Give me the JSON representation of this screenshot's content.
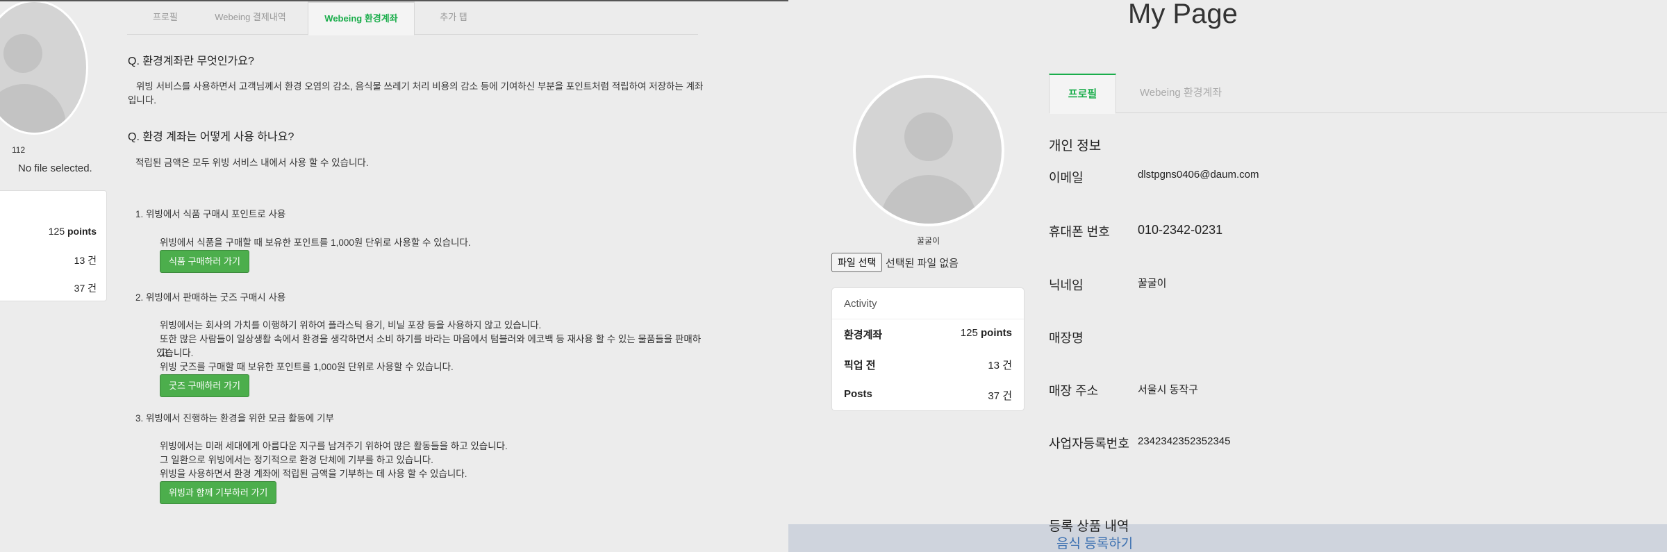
{
  "left": {
    "nickname": "112",
    "no_file": "No file selected.",
    "stats": [
      {
        "value": "125",
        "unit": "points"
      },
      {
        "value": "13 건",
        "unit": ""
      },
      {
        "value": "37 건",
        "unit": ""
      }
    ],
    "tabs": [
      {
        "label": "프로필"
      },
      {
        "label": "Webeing 결제내역"
      },
      {
        "label": "Webeing 환경계좌"
      },
      {
        "label": "추가 탭"
      }
    ],
    "content": {
      "q1": "Q. 환경계좌란 무엇인가요?",
      "a1_line1": "위빙 서비스를 사용하면서 고객님께서 환경 오염의 감소, 음식물 쓰레기 처리 비용의 감소 등에 기여하신 부분을 포인트처럼 적립하여 저장하는 계좌",
      "a1_line2": "입니다.",
      "q2": "Q. 환경 계좌는 어떻게 사용 하나요?",
      "a2": "적립된 금액은 모두 위빙 서비스 내에서 사용 할 수 있습니다.",
      "item1_title": "1. 위빙에서 식품 구매시 포인트로 사용",
      "item1_desc": "위빙에서 식품을 구매할 때 보유한 포인트를 1,000원 단위로 사용할 수 있습니다.",
      "item1_button": "식품 구매하러 가기",
      "item2_title": "2. 위빙에서 판매하는 굿즈 구매시 사용",
      "item2_desc1": "위빙에서는 회사의 가치를 이행하기 위하여 플라스틱 용기, 비닐 포장 등을 사용하지 않고 있습니다.",
      "item2_desc2": "또한 많은 사람들이 일상생활 속에서 환경을 생각하면서 소비 하기를 바라는 마음에서 텀블러와 에코백 등 재사용 할 수 있는 물품들을 판매하고",
      "item2_desc3": "있습니다.",
      "item2_desc4": "위빙 굿즈를 구매할 때 보유한 포인트를 1,000원 단위로 사용할 수 있습니다.",
      "item2_button": "굿즈 구매하러 가기",
      "item3_title": "3. 위빙에서 진행하는 환경을 위한 모금 활동에 기부",
      "item3_desc1": "위빙에서는 미래 세대에게 아름다운 지구를 남겨주기 위하여 많은 활동들을 하고 있습니다.",
      "item3_desc2": "그 일환으로 위빙에서는 정기적으로 환경 단체에 기부를 하고 있습니다.",
      "item3_desc3": "위빙을 사용하면서 환경 계좌에 적립된 금액을 기부하는 데 사용 할 수 있습니다.",
      "item3_button": "위빙과 함께 기부하러 가기"
    }
  },
  "right": {
    "title": "My Page",
    "nickname": "꿀굴이",
    "file_button": "파일 선택",
    "file_text": "선택된 파일 없음",
    "activity": {
      "heading": "Activity",
      "rows": [
        {
          "label": "환경계좌",
          "value": "125",
          "unit": "points"
        },
        {
          "label": "픽업 전",
          "value": "13 건",
          "unit": ""
        },
        {
          "label": "Posts",
          "value": "37 건",
          "unit": ""
        }
      ]
    },
    "tabs": [
      {
        "label": "프로필"
      },
      {
        "label": "Webeing 환경계좌"
      }
    ],
    "section_title": "개인 정보",
    "fields": [
      {
        "label": "이메일",
        "value": "dlstpgns0406@daum.com"
      },
      {
        "label": "휴대폰 번호",
        "value": "010-2342-0231"
      },
      {
        "label": "닉네임",
        "value": "꿀굴이"
      },
      {
        "label": "매장명",
        "value": ""
      },
      {
        "label": "매장 주소",
        "value": "서울시 동작구"
      },
      {
        "label": "사업자등록번호",
        "value": "2342342352352345"
      }
    ],
    "registered_title": "등록 상품 내역",
    "register_link": "음식 등록하기"
  },
  "colors": {
    "accent_green": "#1aad4b",
    "button_green": "#4cae4c",
    "link_blue": "#3a6fb0",
    "background": "#ececec"
  }
}
